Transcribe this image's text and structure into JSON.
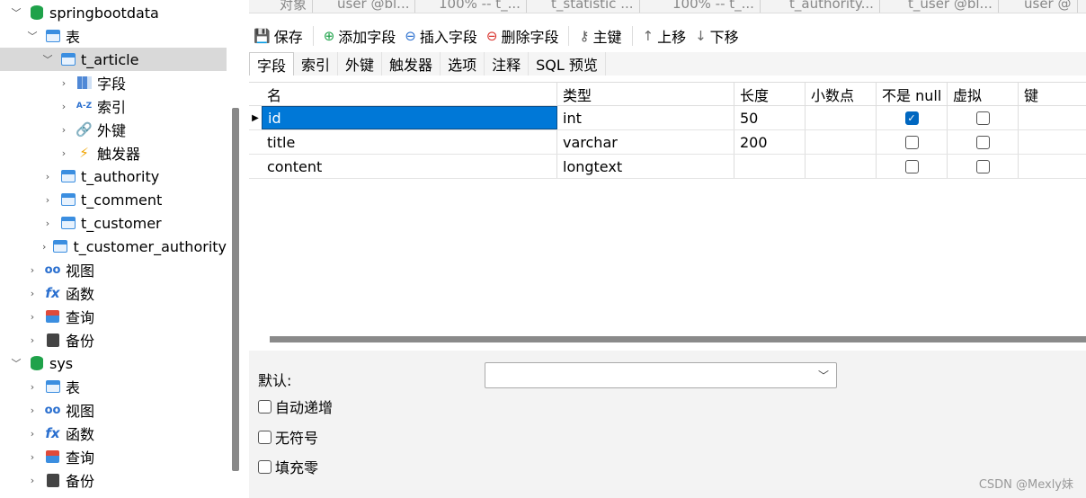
{
  "sidebar": {
    "items": [
      {
        "label": "springbootdata",
        "icon": "database-icon",
        "level": 0,
        "expanded": true
      },
      {
        "label": "表",
        "icon": "table-folder-icon",
        "level": 1,
        "expanded": true
      },
      {
        "label": "t_article",
        "icon": "table-icon",
        "level": 2,
        "expanded": true,
        "selected": true
      },
      {
        "label": "字段",
        "icon": "fields-icon",
        "level": 3
      },
      {
        "label": "索引",
        "icon": "index-icon",
        "level": 3
      },
      {
        "label": "外键",
        "icon": "foreign-key-icon",
        "level": 3
      },
      {
        "label": "触发器",
        "icon": "trigger-icon",
        "level": 3
      },
      {
        "label": "t_authority",
        "icon": "table-icon",
        "level": 2
      },
      {
        "label": "t_comment",
        "icon": "table-icon",
        "level": 2
      },
      {
        "label": "t_customer",
        "icon": "table-icon",
        "level": 2
      },
      {
        "label": "t_customer_authority",
        "icon": "table-icon",
        "level": 2
      },
      {
        "label": "视图",
        "icon": "view-icon",
        "level": 1
      },
      {
        "label": "函数",
        "icon": "function-icon",
        "level": 1
      },
      {
        "label": "查询",
        "icon": "query-icon",
        "level": 1
      },
      {
        "label": "备份",
        "icon": "backup-icon",
        "level": 1
      },
      {
        "label": "sys",
        "icon": "database-icon",
        "level": 0,
        "expanded": true
      },
      {
        "label": "表",
        "icon": "table-folder-icon",
        "level": 1
      },
      {
        "label": "视图",
        "icon": "view-icon",
        "level": 1
      },
      {
        "label": "函数",
        "icon": "function-icon",
        "level": 1
      },
      {
        "label": "查询",
        "icon": "query-icon",
        "level": 1
      },
      {
        "label": "备份",
        "icon": "backup-icon",
        "level": 1
      }
    ]
  },
  "tabs": [
    "对象",
    "user @bl...",
    "100% -- t_...",
    "t_statistic ...",
    "100% -- t_...",
    "t_authority...",
    "t_user @bl...",
    "user @"
  ],
  "toolbar": {
    "save": "保存",
    "add_field": "添加字段",
    "insert_field": "插入字段",
    "delete_field": "删除字段",
    "primary_key": "主键",
    "move_up": "上移",
    "move_down": "下移"
  },
  "subtabs": [
    "字段",
    "索引",
    "外键",
    "触发器",
    "选项",
    "注释",
    "SQL 预览"
  ],
  "grid": {
    "headers": {
      "name": "名",
      "type": "类型",
      "length": "长度",
      "decimals": "小数点",
      "not_null": "不是 null",
      "virtual": "虚拟",
      "key": "键"
    },
    "rows": [
      {
        "name": "id",
        "type": "int",
        "length": "50",
        "decimals": "",
        "not_null": true,
        "virtual": false
      },
      {
        "name": "title",
        "type": "varchar",
        "length": "200",
        "decimals": "",
        "not_null": false,
        "virtual": false
      },
      {
        "name": "content",
        "type": "longtext",
        "length": "",
        "decimals": "",
        "not_null": false,
        "virtual": false
      }
    ]
  },
  "props": {
    "default_label": "默认:",
    "default_value": "",
    "auto_increment": "自动递增",
    "unsigned": "无符号",
    "zerofill": "填充零"
  },
  "watermark": "CSDN @Mexly妹"
}
